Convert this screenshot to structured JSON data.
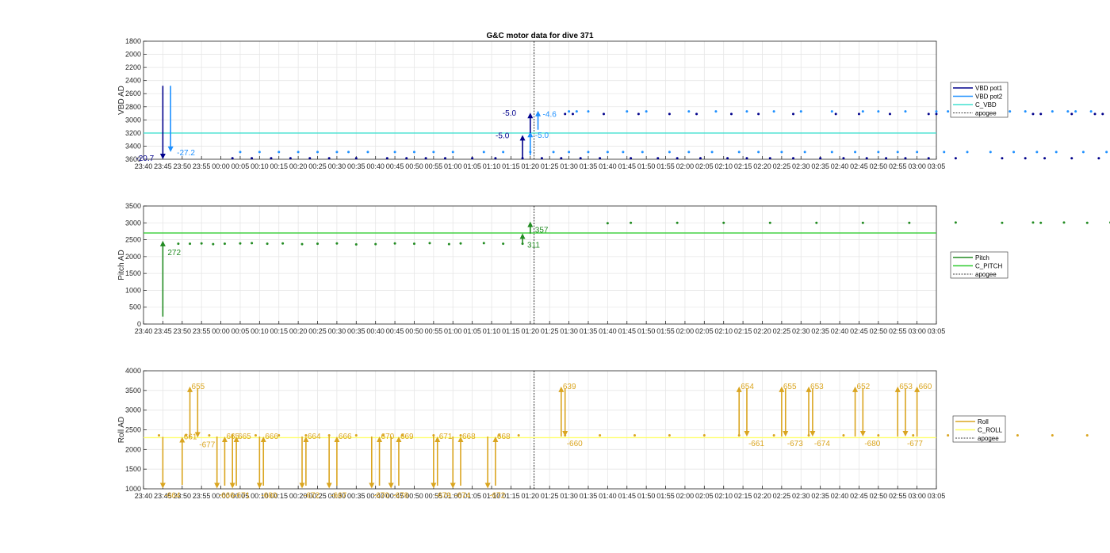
{
  "chart_data": [
    {
      "type": "line",
      "title": "G&C motor data for dive 371",
      "ylabel": "VBD AD",
      "ylim": [
        3600,
        1800
      ],
      "reversed_y": true,
      "y_ticks": [
        1800,
        2000,
        2200,
        2400,
        2600,
        2800,
        3000,
        3200,
        3400,
        "3600"
      ],
      "x_ticks": [
        "23:40",
        "23:45",
        "23:50",
        "23:55",
        "00:00",
        "00:05",
        "00:10",
        "00:15",
        "00:20",
        "00:25",
        "00:30",
        "00:35",
        "00:40",
        "00:45",
        "00:50",
        "00:55",
        "01:00",
        "01:05",
        "01:10",
        "01:15",
        "01:20",
        "01:25",
        "01:30",
        "01:35",
        "01:40",
        "01:45",
        "01:50",
        "01:55",
        "02:00",
        "02:05",
        "02:10",
        "02:15",
        "02:20",
        "02:25",
        "02:30",
        "02:35",
        "02:40",
        "02:45",
        "02:50",
        "02:55",
        "03:00",
        "03:05"
      ],
      "grid": true,
      "legend": {
        "placement": "right",
        "entries": [
          "VBD pot1",
          "VBD pot2",
          "C_VBD",
          "apogee"
        ]
      },
      "colors": {
        "pot1": "#00008b",
        "pot2": "#1e90ff",
        "c_vbd": "#40e0d0",
        "apogee": "#000000"
      },
      "c_vbd": 3200,
      "apogee_min": 101,
      "pot1_x": [
        23,
        28,
        33,
        38,
        43,
        48,
        55,
        63,
        68,
        73,
        78,
        85,
        91,
        98,
        103,
        108,
        113,
        118,
        126,
        133,
        138,
        144,
        151,
        156,
        162,
        168,
        175,
        181,
        187,
        192,
        197,
        203,
        210,
        222,
        228,
        233,
        240,
        247,
        252,
        260,
        265,
        270,
        276,
        282,
        287,
        293,
        300,
        305,
        312,
        319,
        325,
        330,
        337,
        343,
        349,
        354,
        359,
        364,
        369,
        374,
        377,
        379
      ],
      "pot1_y": 3585,
      "pot2_x": [
        25,
        30,
        35,
        40,
        45,
        50,
        53,
        58,
        65,
        70,
        75,
        80,
        88,
        93,
        100,
        106,
        110,
        115,
        120,
        124,
        129,
        136,
        141,
        147,
        154,
        159,
        165,
        171,
        178,
        184,
        190,
        195,
        200,
        207,
        213,
        219,
        225,
        231,
        236,
        243,
        249,
        255,
        262,
        267,
        273,
        279,
        285,
        290,
        296,
        302,
        308,
        314,
        321,
        327,
        333,
        339,
        345,
        351,
        356,
        361,
        366,
        371,
        376,
        381
      ],
      "pot2_y": 3490,
      "pot1_late_x": [
        109,
        111,
        119,
        128,
        136,
        143,
        152,
        159,
        168,
        179,
        185,
        193,
        203,
        205,
        209,
        215,
        219,
        221,
        230,
        232,
        240,
        246,
        248,
        256,
        262,
        266,
        270,
        272,
        276,
        279,
        282,
        285,
        289,
        293,
        297,
        300,
        303,
        306,
        310,
        313,
        316,
        319,
        322,
        325,
        328,
        331,
        334,
        337,
        340,
        343,
        346,
        349,
        352,
        355,
        358,
        361
      ],
      "pot1_late_y": 2910,
      "pot2_late_x": [
        110,
        112,
        115,
        125,
        130,
        141,
        148,
        156,
        163,
        170,
        178,
        186,
        190,
        197,
        205,
        208,
        211,
        217,
        222,
        224,
        228,
        235,
        239,
        241,
        245,
        252,
        255,
        260,
        264,
        268,
        271,
        275,
        278,
        281,
        284,
        287,
        290,
        294,
        298,
        301,
        304,
        307,
        311,
        314,
        317,
        320,
        323,
        326,
        329,
        332,
        335,
        338,
        341,
        344,
        347,
        350,
        353,
        356,
        359,
        362
      ],
      "pot2_late_y": 2870,
      "arrows": [
        {
          "series": "pot1",
          "x": 5,
          "y_from": 2480,
          "y_to": 3600,
          "label": "-20.7"
        },
        {
          "series": "pot2",
          "x": 7,
          "y_from": 2480,
          "y_to": 3490,
          "label": "-27.2"
        },
        {
          "series": "pot1",
          "x": 98,
          "y_from": 3580,
          "y_to": 3230,
          "label": "-5.0"
        },
        {
          "series": "pot2",
          "x": 100,
          "y_from": 3540,
          "y_to": 3180,
          "label": "-5.0"
        },
        {
          "series": "pot1",
          "x": 100,
          "y_from": 3200,
          "y_to": 2890,
          "label": "-5.0"
        },
        {
          "series": "pot2",
          "x": 102,
          "y_from": 3150,
          "y_to": 2860,
          "label": "-4.6"
        }
      ],
      "annotations": [
        "-20.7",
        "-27.2",
        "-5.0",
        "-5.0",
        "-5.0",
        "-4.6"
      ]
    },
    {
      "type": "line",
      "ylabel": "Pitch AD",
      "ylim": [
        0,
        3500
      ],
      "y_ticks": [
        0,
        500,
        1000,
        1500,
        2000,
        2500,
        3000,
        3500
      ],
      "x_ticks": [
        "23:40",
        "23:45",
        "23:50",
        "23:55",
        "00:00",
        "00:05",
        "00:10",
        "00:15",
        "00:20",
        "00:25",
        "00:30",
        "00:35",
        "00:40",
        "00:45",
        "00:50",
        "00:55",
        "01:00",
        "01:05",
        "01:10",
        "01:15",
        "01:20",
        "01:25",
        "01:30",
        "01:35",
        "01:40",
        "01:45",
        "01:50",
        "01:55",
        "02:00",
        "02:05",
        "02:10",
        "02:15",
        "02:20",
        "02:25",
        "02:30",
        "02:35",
        "02:40",
        "02:45",
        "02:50",
        "02:55",
        "03:00",
        "03:05"
      ],
      "grid": true,
      "legend": {
        "placement": "right",
        "entries": [
          "Pitch",
          "C_PITCH",
          "apogee"
        ]
      },
      "colors": {
        "pitch": "#228b22",
        "c_pitch": "#32cd32",
        "apogee": "#000000"
      },
      "c_pitch": 2700,
      "apogee_min": 101,
      "pitch_x": [
        9,
        12,
        15,
        18,
        21,
        25,
        28,
        32,
        36,
        41,
        45,
        50,
        55,
        60,
        65,
        70,
        74,
        79,
        82,
        88,
        93,
        98,
        108,
        113,
        118,
        125,
        132,
        136,
        142,
        150,
        156,
        162,
        168,
        172,
        176,
        182,
        188,
        194,
        200,
        206,
        210,
        214,
        220,
        226,
        232,
        238,
        243,
        248,
        254,
        259,
        263,
        268,
        273,
        277,
        281,
        285,
        289,
        293,
        297,
        301,
        305,
        309,
        313,
        317,
        320,
        323,
        326,
        329,
        332,
        335,
        338,
        341,
        344,
        347,
        350,
        353,
        356,
        359,
        362
      ],
      "pitch_y": [
        2380,
        2380,
        2390,
        2370,
        2380,
        2390,
        2400,
        2380,
        2390,
        2370,
        2380,
        2390,
        2360,
        2370,
        2390,
        2380,
        2400,
        2370,
        2390,
        2400,
        2380,
        2380,
        2380,
        2380,
        2390,
        2380,
        2370,
        2370,
        2380,
        2380,
        2380,
        2380,
        2370,
        2370,
        2370,
        2380,
        2380,
        2380,
        2380,
        2390,
        2380,
        2380,
        2380,
        2380,
        2380,
        2390,
        2380,
        2370,
        2380,
        2380,
        2380,
        3000,
        3000,
        3010,
        3000,
        3000,
        3000,
        3000,
        3000,
        3010,
        3000,
        3010,
        3010,
        3010,
        3000,
        3000,
        3010,
        3000,
        3000,
        3000,
        3000,
        3000,
        3000,
        3000,
        3000,
        3000,
        3000,
        3000,
        3000
      ],
      "pitch_late_x": [
        120,
        126,
        138,
        150,
        162,
        174,
        186,
        198,
        210,
        222,
        230,
        232,
        238,
        244,
        250,
        254,
        258,
        262,
        266,
        272,
        280,
        284,
        288,
        292,
        296,
        300,
        304,
        306,
        310,
        314,
        318,
        322,
        326,
        330,
        334,
        338,
        342,
        346,
        350,
        354,
        358,
        362
      ],
      "pitch_late_y": [
        2990,
        3000,
        3000,
        3000,
        3000,
        3000,
        3000,
        3000,
        3010,
        3000,
        3010,
        3000,
        3010,
        3000,
        3010,
        3000,
        3010,
        3000,
        3010,
        3000,
        3010,
        3010,
        3000,
        3010,
        3000,
        3000,
        3010,
        3000,
        3010,
        3000,
        3010,
        3000,
        3000,
        3010,
        3010,
        3000,
        3000,
        3000,
        3010,
        3000,
        3000,
        3000
      ],
      "arrows": [
        {
          "x": 5,
          "y_from": 220,
          "y_to": 2470,
          "label": "272"
        },
        {
          "x": 98,
          "y_from": 2380,
          "y_to": 2690,
          "label": "311"
        },
        {
          "x": 100,
          "y_from": 2680,
          "y_to": 3040,
          "label": "357"
        }
      ],
      "annotations": [
        "272",
        "311",
        "357"
      ]
    },
    {
      "type": "line",
      "ylabel": "Roll AD",
      "ylim": [
        1000,
        4000
      ],
      "y_ticks": [
        1000,
        1500,
        2000,
        2500,
        3000,
        3500,
        4000
      ],
      "x_ticks": [
        "23:40",
        "23:45",
        "23:50",
        "23:55",
        "00:00",
        "00:05",
        "00:10",
        "00:15",
        "00:20",
        "00:25",
        "00:30",
        "00:35",
        "00:40",
        "00:45",
        "00:50",
        "00:55",
        "01:00",
        "01:05",
        "01:10",
        "01:15",
        "01:20",
        "01:25",
        "01:30",
        "01:35",
        "01:40",
        "01:45",
        "01:50",
        "01:55",
        "02:00",
        "02:05",
        "02:10",
        "02:15",
        "02:20",
        "02:25",
        "02:30",
        "02:35",
        "02:40",
        "02:45",
        "02:50",
        "02:55",
        "03:00",
        "03:05"
      ],
      "grid": true,
      "legend": {
        "placement": "right",
        "entries": [
          "Roll",
          "C_ROLL",
          "apogee"
        ]
      },
      "colors": {
        "roll": "#daa520",
        "c_roll": "#ffff66",
        "apogee": "#000000"
      },
      "c_roll": 2300,
      "apogee_min": 101,
      "roll_dots_x": [
        4,
        11,
        17,
        23,
        29,
        35,
        42,
        48,
        55,
        62,
        67,
        75,
        82,
        92,
        97,
        109,
        118,
        127,
        136,
        145,
        154,
        163,
        172,
        181,
        190,
        199,
        208,
        217,
        226,
        235,
        244,
        253,
        262,
        271,
        280,
        289,
        298,
        307,
        316,
        325,
        334,
        343,
        352,
        361
      ],
      "roll_dots_y": 2360,
      "arrows": [
        {
          "x": 5,
          "y_from": 2320,
          "y_to": 1010,
          "label": "-664",
          "down": true
        },
        {
          "x": 10,
          "y_from": 1100,
          "y_to": 2320,
          "label": "661",
          "down": false
        },
        {
          "x": 12,
          "y_from": 2300,
          "y_to": 3600,
          "label": "655",
          "down": false
        },
        {
          "x": 14,
          "y_from": 3550,
          "y_to": 2300,
          "label": "-677",
          "down": true
        },
        {
          "x": 19,
          "y_from": 2330,
          "y_to": 1010,
          "label": "-666",
          "down": true
        },
        {
          "x": 21,
          "y_from": 1080,
          "y_to": 2330,
          "label": "665",
          "down": false
        },
        {
          "x": 23,
          "y_from": 2330,
          "y_to": 1010,
          "label": "-671",
          "down": true
        },
        {
          "x": 24,
          "y_from": 1080,
          "y_to": 2330,
          "label": "665",
          "down": false
        },
        {
          "x": 30,
          "y_from": 2330,
          "y_to": 1010,
          "label": "-680",
          "down": true
        },
        {
          "x": 31,
          "y_from": 1080,
          "y_to": 2330,
          "label": "666",
          "down": false
        },
        {
          "x": 41,
          "y_from": 2330,
          "y_to": 1010,
          "label": "-672",
          "down": true
        },
        {
          "x": 42,
          "y_from": 1080,
          "y_to": 2330,
          "label": "664",
          "down": false
        },
        {
          "x": 48,
          "y_from": 2330,
          "y_to": 1010,
          "label": "-667",
          "down": true
        },
        {
          "x": 50,
          "y_from": 1080,
          "y_to": 2330,
          "label": "666",
          "down": false
        },
        {
          "x": 59,
          "y_from": 2330,
          "y_to": 1010,
          "label": "-670",
          "down": true
        },
        {
          "x": 61,
          "y_from": 1080,
          "y_to": 2330,
          "label": "670",
          "down": false
        },
        {
          "x": 64,
          "y_from": 2330,
          "y_to": 1010,
          "label": "-678",
          "down": true
        },
        {
          "x": 66,
          "y_from": 1080,
          "y_to": 2330,
          "label": "669",
          "down": false
        },
        {
          "x": 75,
          "y_from": 2330,
          "y_to": 1010,
          "label": "-679",
          "down": true
        },
        {
          "x": 76,
          "y_from": 1080,
          "y_to": 2330,
          "label": "671",
          "down": false
        },
        {
          "x": 80,
          "y_from": 2330,
          "y_to": 1010,
          "label": "-674",
          "down": true
        },
        {
          "x": 82,
          "y_from": 1080,
          "y_to": 2330,
          "label": "668",
          "down": false
        },
        {
          "x": 89,
          "y_from": 2330,
          "y_to": 1010,
          "label": "-672",
          "down": true
        },
        {
          "x": 91,
          "y_from": 1080,
          "y_to": 2330,
          "label": "668",
          "down": false
        },
        {
          "x": 108,
          "y_from": 2330,
          "y_to": 3600,
          "label": "639",
          "down": false
        },
        {
          "x": 109,
          "y_from": 3550,
          "y_to": 2330,
          "label": "-660",
          "down": true
        },
        {
          "x": 154,
          "y_from": 2330,
          "y_to": 3600,
          "label": "654",
          "down": false
        },
        {
          "x": 156,
          "y_from": 3550,
          "y_to": 2330,
          "label": "-661",
          "down": true
        },
        {
          "x": 165,
          "y_from": 2330,
          "y_to": 3600,
          "label": "655",
          "down": false
        },
        {
          "x": 166,
          "y_from": 3550,
          "y_to": 2330,
          "label": "-673",
          "down": true
        },
        {
          "x": 172,
          "y_from": 2330,
          "y_to": 3600,
          "label": "653",
          "down": false
        },
        {
          "x": 173,
          "y_from": 3550,
          "y_to": 2330,
          "label": "-674",
          "down": true
        },
        {
          "x": 184,
          "y_from": 2330,
          "y_to": 3600,
          "label": "652",
          "down": false
        },
        {
          "x": 186,
          "y_from": 3550,
          "y_to": 2330,
          "label": "-680",
          "down": true
        },
        {
          "x": 195,
          "y_from": 2330,
          "y_to": 3600,
          "label": "653",
          "down": false
        },
        {
          "x": 197,
          "y_from": 3550,
          "y_to": 2330,
          "label": "-677",
          "down": true
        },
        {
          "x": 200,
          "y_from": 2330,
          "y_to": 3600,
          "label": "660",
          "down": false
        }
      ],
      "annotations": [
        "-664",
        "661",
        "655",
        "-677",
        "-666",
        "665",
        "-671",
        "665",
        "-680",
        "666",
        "-672",
        "664",
        "-667",
        "666",
        "-670",
        "670",
        "-678",
        "669",
        "-679",
        "671",
        "-674",
        "668",
        "-672",
        "668",
        "639",
        "-660",
        "654",
        "-661",
        "655",
        "-673",
        "653",
        "-674",
        "652",
        "-680",
        "653",
        "-677",
        "660"
      ]
    }
  ]
}
